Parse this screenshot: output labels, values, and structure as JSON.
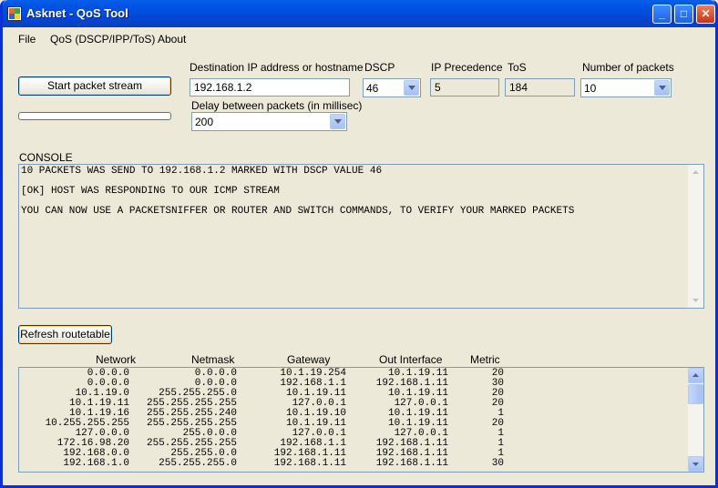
{
  "window": {
    "title": "Asknet - QoS Tool",
    "controls": {
      "minimize": "_",
      "maximize": "□",
      "close": "✕"
    }
  },
  "menu": {
    "items": [
      "File",
      "QoS (DSCP/IPP/ToS)",
      "About"
    ]
  },
  "form": {
    "start_button": "Start packet stream",
    "progress": 0,
    "dest_label": "Destination IP address or hostname",
    "dest_value": "192.168.1.2",
    "dscp_label": "DSCP",
    "dscp_value": "46",
    "ipp_label": "IP Precedence",
    "ipp_value": "5",
    "tos_label": "ToS",
    "tos_value": "184",
    "num_label": "Number of packets",
    "num_value": "10",
    "delay_label": "Delay between packets (in millisec)",
    "delay_value": "200"
  },
  "console": {
    "label": "CONSOLE",
    "lines": [
      "10 PACKETS WAS SEND TO 192.168.1.2 MARKED WITH DSCP VALUE 46",
      "[OK] HOST WAS RESPONDING TO OUR ICMP STREAM",
      "YOU CAN NOW USE A PACKETSNIFFER OR ROUTER AND SWITCH COMMANDS, TO VERIFY YOUR MARKED PACKETS"
    ]
  },
  "routes": {
    "refresh_button": "Refresh routetable",
    "headers": {
      "network": "Network",
      "netmask": "Netmask",
      "gateway": "Gateway",
      "interface": "Out Interface",
      "metric": "Metric"
    },
    "rows": [
      {
        "network": "0.0.0.0",
        "netmask": "0.0.0.0",
        "gateway": "10.1.19.254",
        "interface": "10.1.19.11",
        "metric": "20"
      },
      {
        "network": "0.0.0.0",
        "netmask": "0.0.0.0",
        "gateway": "192.168.1.1",
        "interface": "192.168.1.11",
        "metric": "30"
      },
      {
        "network": "10.1.19.0",
        "netmask": "255.255.255.0",
        "gateway": "10.1.19.11",
        "interface": "10.1.19.11",
        "metric": "20"
      },
      {
        "network": "10.1.19.11",
        "netmask": "255.255.255.255",
        "gateway": "127.0.0.1",
        "interface": "127.0.0.1",
        "metric": "20"
      },
      {
        "network": "10.1.19.16",
        "netmask": "255.255.255.240",
        "gateway": "10.1.19.10",
        "interface": "10.1.19.11",
        "metric": "1"
      },
      {
        "network": "10.255.255.255",
        "netmask": "255.255.255.255",
        "gateway": "10.1.19.11",
        "interface": "10.1.19.11",
        "metric": "20"
      },
      {
        "network": "127.0.0.0",
        "netmask": "255.0.0.0",
        "gateway": "127.0.0.1",
        "interface": "127.0.0.1",
        "metric": "1"
      },
      {
        "network": "172.16.98.20",
        "netmask": "255.255.255.255",
        "gateway": "192.168.1.1",
        "interface": "192.168.1.11",
        "metric": "1"
      },
      {
        "network": "192.168.0.0",
        "netmask": "255.255.0.0",
        "gateway": "192.168.1.11",
        "interface": "192.168.1.11",
        "metric": "1"
      },
      {
        "network": "192.168.1.0",
        "netmask": "255.255.255.0",
        "gateway": "192.168.1.11",
        "interface": "192.168.1.11",
        "metric": "30"
      }
    ]
  },
  "colors": {
    "titlebar": "#0055e5",
    "face": "#ece9d8",
    "border": "#7f9db9"
  }
}
